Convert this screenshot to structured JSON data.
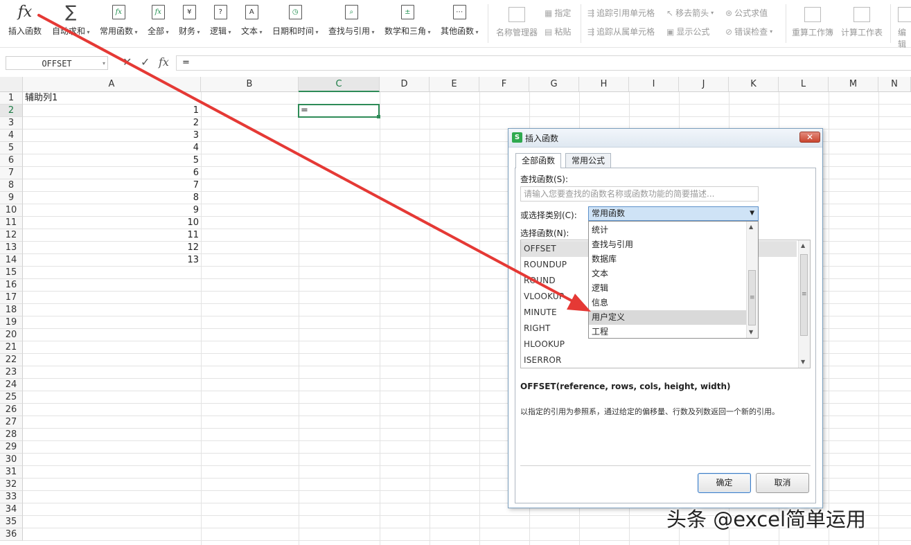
{
  "ribbon": {
    "buttons": [
      {
        "label": "插入函数",
        "icon": "fx-icon",
        "glyph": "fx"
      },
      {
        "label": "自动求和",
        "icon": "sigma-icon",
        "glyph": "∑"
      },
      {
        "label": "常用函数",
        "icon": "common-functions-icon",
        "glyph": "fx"
      },
      {
        "label": "全部",
        "icon": "all-functions-icon",
        "glyph": "fx"
      },
      {
        "label": "财务",
        "icon": "finance-icon",
        "glyph": "¥"
      },
      {
        "label": "逻辑",
        "icon": "logic-icon",
        "glyph": "?"
      },
      {
        "label": "文本",
        "icon": "text-icon",
        "glyph": "A"
      },
      {
        "label": "日期和时间",
        "icon": "clock-icon",
        "glyph": "◷"
      },
      {
        "label": "查找与引用",
        "icon": "lookup-icon",
        "glyph": "⌕"
      },
      {
        "label": "数学和三角",
        "icon": "math-icon",
        "glyph": "±"
      },
      {
        "label": "其他函数",
        "icon": "more-functions-icon",
        "glyph": "⋯"
      }
    ],
    "name_manager": "名称管理器",
    "define_name": "指定",
    "paste": "粘贴",
    "trace_precedents": "追踪引用单元格",
    "trace_dependents": "追踪从属单元格",
    "remove_arrows": "移去箭头",
    "show_formulas": "显示公式",
    "evaluate_formula": "公式求值",
    "error_check": "错误检查",
    "recalc_workbook": "重算工作簿",
    "calc_sheet": "计算工作表",
    "edit_cut": "编辑"
  },
  "formula_bar": {
    "name_box": "OFFSET",
    "cancel_icon": "✕",
    "enter_icon": "✓",
    "fx_label": "fx",
    "content": "="
  },
  "sheet": {
    "columns": [
      "A",
      "B",
      "C",
      "D",
      "E",
      "F",
      "G",
      "H",
      "I",
      "J",
      "K",
      "L",
      "M",
      "N"
    ],
    "rows": [
      "1",
      "2",
      "3",
      "4",
      "5",
      "6",
      "7",
      "8",
      "9",
      "10",
      "11",
      "12",
      "13",
      "14",
      "15",
      "16",
      "17",
      "18",
      "19",
      "20",
      "21",
      "22",
      "23",
      "24",
      "25",
      "26",
      "27",
      "28",
      "29",
      "30",
      "31",
      "32",
      "33",
      "34",
      "35",
      "36"
    ],
    "a1": "辅助列1",
    "a_values": [
      "1",
      "2",
      "3",
      "4",
      "5",
      "6",
      "7",
      "8",
      "9",
      "10",
      "11",
      "12",
      "13"
    ],
    "active_cell_content": "="
  },
  "dialog": {
    "title": "插入函数",
    "close_label": "✕",
    "tabs": [
      "全部函数",
      "常用公式"
    ],
    "search_label": "查找函数(S):",
    "search_placeholder": "请输入您要查找的函数名称或函数功能的简要描述...",
    "category_label": "或选择类别(C):",
    "category_value": "常用函数",
    "function_label": "选择函数(N):",
    "functions": [
      "OFFSET",
      "ROUNDUP",
      "ROUND",
      "VLOOKUP",
      "MINUTE",
      "RIGHT",
      "HLOOKUP",
      "ISERROR"
    ],
    "category_options": [
      "统计",
      "查找与引用",
      "数据库",
      "文本",
      "逻辑",
      "信息",
      "用户定义",
      "工程"
    ],
    "highlighted_option": "用户定义",
    "signature": "OFFSET(reference, rows, cols, height, width)",
    "description": "以指定的引用为参照系，通过给定的偏移量、行数及列数返回一个新的引用。",
    "ok": "确定",
    "cancel": "取消"
  },
  "watermark": "头条 @excel简单运用",
  "colors": {
    "accent_green": "#2e8b57",
    "arrow_red": "#e53935",
    "dialog_border": "#7a9ebd",
    "selection_blue": "#cfe3f6"
  }
}
